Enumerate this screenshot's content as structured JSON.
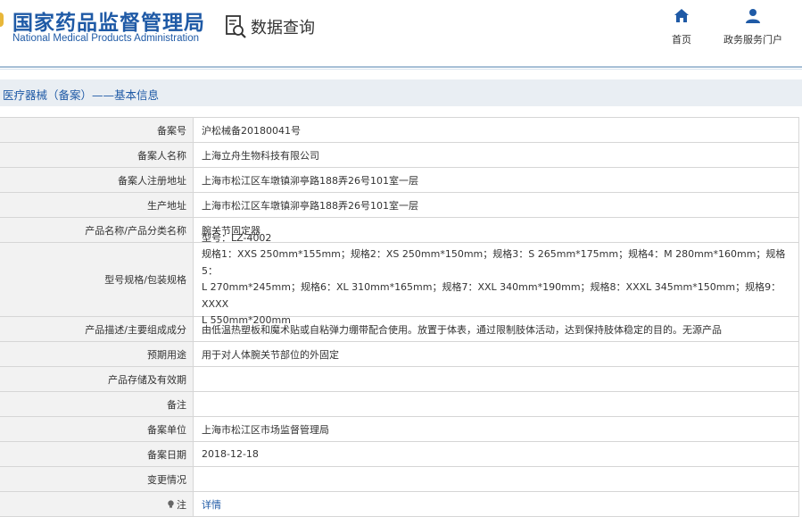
{
  "header": {
    "logo_cn": "国家药品监督管理局",
    "logo_en": "National Medical Products Administration",
    "page_label": "数据查询",
    "nav": [
      {
        "label": "首页",
        "icon": "home-icon"
      },
      {
        "label": "政务服务门户",
        "icon": "user-icon"
      }
    ]
  },
  "title": "医疗器械（备案）——基本信息",
  "colors": {
    "brand": "#1f5aa6",
    "label_bg": "#f2f2f2",
    "title_bg": "#e9eef3"
  },
  "rows": [
    {
      "label": "备案号",
      "value": "沪松械备20180041号"
    },
    {
      "label": "备案人名称",
      "value": "上海立舟生物科技有限公司"
    },
    {
      "label": "备案人注册地址",
      "value": "上海市松江区车墩镇泖亭路188弄26号101室一层"
    },
    {
      "label": "生产地址",
      "value": "上海市松江区车墩镇泖亭路188弄26号101室一层"
    },
    {
      "label": "产品名称/产品分类名称",
      "value": "腕关节固定器"
    },
    {
      "label": "型号规格/包装规格",
      "lines": [
        "型号：LZ-4002",
        "规格1：XXS 250mm*155mm；规格2：XS 250mm*150mm；规格3：S 265mm*175mm；规格4：M 280mm*160mm；规格5：",
        "L 270mm*245mm；规格6：XL 310mm*165mm；规格7：XXL 340mm*190mm；规格8：XXXL 345mm*150mm；规格9：XXXX",
        "L 550mm*200mm"
      ]
    },
    {
      "label": "产品描述/主要组成成分",
      "value": "由低温热塑板和魔术贴或自粘弹力绷带配合使用。放置于体表，通过限制肢体活动，达到保持肢体稳定的目的。无源产品"
    },
    {
      "label": "预期用途",
      "value": "用于对人体腕关节部位的外固定"
    },
    {
      "label": "产品存储及有效期",
      "value": ""
    },
    {
      "label": "备注",
      "value": ""
    },
    {
      "label": "备案单位",
      "value": "上海市松江区市场监督管理局"
    },
    {
      "label": "备案日期",
      "value": "2018-12-18"
    },
    {
      "label": "变更情况",
      "value": ""
    },
    {
      "label": "注",
      "value": "详情"
    }
  ]
}
